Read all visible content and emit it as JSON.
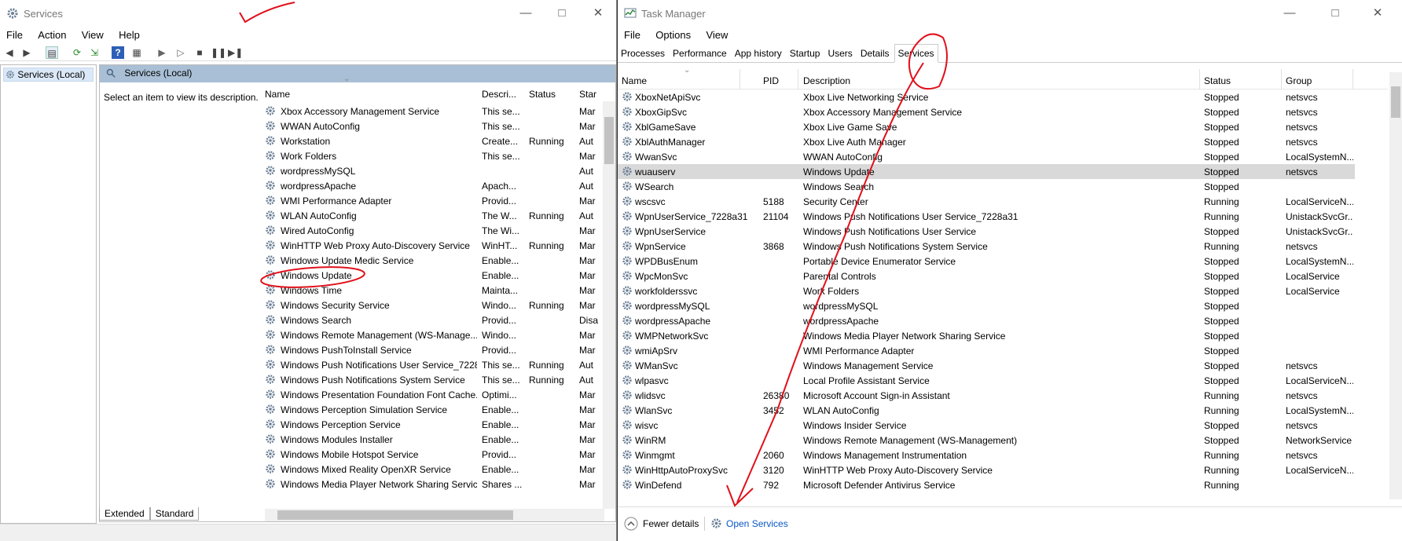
{
  "services_window": {
    "title": "Services",
    "menu": [
      "File",
      "Action",
      "View",
      "Help"
    ],
    "tree_item": "Services (Local)",
    "pane_title": "Services (Local)",
    "description_hint": "Select an item to view its description.",
    "columns": [
      "Name",
      "Descri...",
      "Status",
      "Star"
    ],
    "rows": [
      [
        "Xbox Accessory Management Service",
        "This se...",
        "",
        "Mar"
      ],
      [
        "WWAN AutoConfig",
        "This se...",
        "",
        "Mar"
      ],
      [
        "Workstation",
        "Create...",
        "Running",
        "Aut"
      ],
      [
        "Work Folders",
        "This se...",
        "",
        "Mar"
      ],
      [
        "wordpressMySQL",
        "",
        "",
        "Aut"
      ],
      [
        "wordpressApache",
        "Apach...",
        "",
        "Aut"
      ],
      [
        "WMI Performance Adapter",
        "Provid...",
        "",
        "Mar"
      ],
      [
        "WLAN AutoConfig",
        "The W...",
        "Running",
        "Aut"
      ],
      [
        "Wired AutoConfig",
        "The Wi...",
        "",
        "Mar"
      ],
      [
        "WinHTTP Web Proxy Auto-Discovery Service",
        "WinHT...",
        "Running",
        "Mar"
      ],
      [
        "Windows Update Medic Service",
        "Enable...",
        "",
        "Mar"
      ],
      [
        "Windows Update",
        "Enable...",
        "",
        "Mar"
      ],
      [
        "Windows Time",
        "Mainta...",
        "",
        "Mar"
      ],
      [
        "Windows Security Service",
        "Windo...",
        "Running",
        "Mar"
      ],
      [
        "Windows Search",
        "Provid...",
        "",
        "Disa"
      ],
      [
        "Windows Remote Management (WS-Manage...",
        "Windo...",
        "",
        "Mar"
      ],
      [
        "Windows PushToInstall Service",
        "Provid...",
        "",
        "Mar"
      ],
      [
        "Windows Push Notifications User Service_7228...",
        "This se...",
        "Running",
        "Aut"
      ],
      [
        "Windows Push Notifications System Service",
        "This se...",
        "Running",
        "Aut"
      ],
      [
        "Windows Presentation Foundation Font Cache...",
        "Optimi...",
        "",
        "Mar"
      ],
      [
        "Windows Perception Simulation Service",
        "Enable...",
        "",
        "Mar"
      ],
      [
        "Windows Perception Service",
        "Enable...",
        "",
        "Mar"
      ],
      [
        "Windows Modules Installer",
        "Enable...",
        "",
        "Mar"
      ],
      [
        "Windows Mobile Hotspot Service",
        "Provid...",
        "",
        "Mar"
      ],
      [
        "Windows Mixed Reality OpenXR Service",
        "Enable...",
        "",
        "Mar"
      ],
      [
        "Windows Media Player Network Sharing Service",
        "Shares ...",
        "",
        "Mar"
      ]
    ],
    "tabs": [
      "Extended",
      "Standard"
    ]
  },
  "task_manager": {
    "title": "Task Manager",
    "menu": [
      "File",
      "Options",
      "View"
    ],
    "tabs": [
      "Processes",
      "Performance",
      "App history",
      "Startup",
      "Users",
      "Details",
      "Services"
    ],
    "active_tab": "Services",
    "columns": [
      "Name",
      "PID",
      "Description",
      "Status",
      "Group"
    ],
    "selected_row": "wuauserv",
    "rows": [
      [
        "XboxNetApiSvc",
        "",
        "Xbox Live Networking Service",
        "Stopped",
        "netsvcs"
      ],
      [
        "XboxGipSvc",
        "",
        "Xbox Accessory Management Service",
        "Stopped",
        "netsvcs"
      ],
      [
        "XblGameSave",
        "",
        "Xbox Live Game Save",
        "Stopped",
        "netsvcs"
      ],
      [
        "XblAuthManager",
        "",
        "Xbox Live Auth Manager",
        "Stopped",
        "netsvcs"
      ],
      [
        "WwanSvc",
        "",
        "WWAN AutoConfig",
        "Stopped",
        "LocalSystemN..."
      ],
      [
        "wuauserv",
        "",
        "Windows Update",
        "Stopped",
        "netsvcs"
      ],
      [
        "WSearch",
        "",
        "Windows Search",
        "Stopped",
        ""
      ],
      [
        "wscsvc",
        "5188",
        "Security Center",
        "Running",
        "LocalServiceN..."
      ],
      [
        "WpnUserService_7228a31",
        "21104",
        "Windows Push Notifications User Service_7228a31",
        "Running",
        "UnistackSvcGr..."
      ],
      [
        "WpnUserService",
        "",
        "Windows Push Notifications User Service",
        "Stopped",
        "UnistackSvcGr..."
      ],
      [
        "WpnService",
        "3868",
        "Windows Push Notifications System Service",
        "Running",
        "netsvcs"
      ],
      [
        "WPDBusEnum",
        "",
        "Portable Device Enumerator Service",
        "Stopped",
        "LocalSystemN..."
      ],
      [
        "WpcMonSvc",
        "",
        "Parental Controls",
        "Stopped",
        "LocalService"
      ],
      [
        "workfolderssvc",
        "",
        "Work Folders",
        "Stopped",
        "LocalService"
      ],
      [
        "wordpressMySQL",
        "",
        "wordpressMySQL",
        "Stopped",
        ""
      ],
      [
        "wordpressApache",
        "",
        "wordpressApache",
        "Stopped",
        ""
      ],
      [
        "WMPNetworkSvc",
        "",
        "Windows Media Player Network Sharing Service",
        "Stopped",
        ""
      ],
      [
        "wmiApSrv",
        "",
        "WMI Performance Adapter",
        "Stopped",
        ""
      ],
      [
        "WManSvc",
        "",
        "Windows Management Service",
        "Stopped",
        "netsvcs"
      ],
      [
        "wlpasvc",
        "",
        "Local Profile Assistant Service",
        "Stopped",
        "LocalServiceN..."
      ],
      [
        "wlidsvc",
        "26380",
        "Microsoft Account Sign-in Assistant",
        "Running",
        "netsvcs"
      ],
      [
        "WlanSvc",
        "3452",
        "WLAN AutoConfig",
        "Running",
        "LocalSystemN..."
      ],
      [
        "wisvc",
        "",
        "Windows Insider Service",
        "Stopped",
        "netsvcs"
      ],
      [
        "WinRM",
        "",
        "Windows Remote Management (WS-Management)",
        "Stopped",
        "NetworkService"
      ],
      [
        "Winmgmt",
        "2060",
        "Windows Management Instrumentation",
        "Running",
        "netsvcs"
      ],
      [
        "WinHttpAutoProxySvc",
        "3120",
        "WinHTTP Web Proxy Auto-Discovery Service",
        "Running",
        "LocalServiceN..."
      ],
      [
        "WinDefend",
        "792",
        "Microsoft Defender Antivirus Service",
        "Running",
        ""
      ]
    ],
    "fewer_details": "Fewer details",
    "open_services": "Open Services"
  },
  "colors": {
    "annotation": "#e0101a",
    "link": "#0a58c7",
    "selected_row": "#d9d9d9"
  }
}
